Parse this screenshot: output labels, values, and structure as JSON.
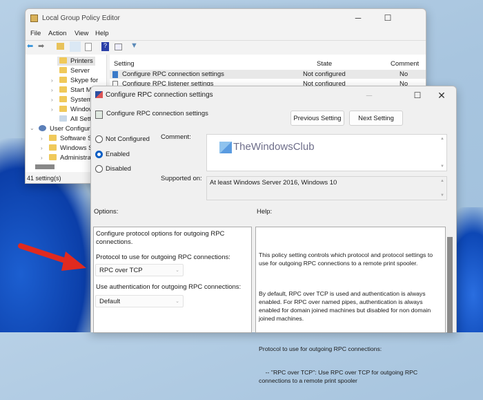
{
  "gpe": {
    "title": "Local Group Policy Editor",
    "menu": [
      "File",
      "Action",
      "View",
      "Help"
    ],
    "tree": [
      "Printers",
      "Server",
      "Skype for",
      "Start Me",
      "System",
      "Window",
      "All Setti",
      "User Configura",
      "Software Se",
      "Windows Se",
      "Administrat"
    ],
    "columns": {
      "setting": "Setting",
      "state": "State",
      "comment": "Comment"
    },
    "rows": [
      {
        "name": "Configure RPC connection settings",
        "state": "Not configured",
        "comment": "No"
      },
      {
        "name": "Configure RPC listener settings",
        "state": "Not configured",
        "comment": "No"
      }
    ],
    "status": "41 setting(s)"
  },
  "dialog": {
    "title": "Configure RPC connection settings",
    "heading": "Configure RPC connection settings",
    "prev": "Previous Setting",
    "next": "Next Setting",
    "radios": {
      "not_configured": "Not Configured",
      "enabled": "Enabled",
      "disabled": "Disabled",
      "selected": "Enabled"
    },
    "comment_label": "Comment:",
    "watermark": "TheWindowsClub",
    "supported_label": "Supported on:",
    "supported_value": "At least Windows Server 2016, Windows 10",
    "options_label": "Options:",
    "help_label": "Help:",
    "options": {
      "intro": "Configure protocol options for outgoing RPC connections.",
      "protocol_label": "Protocol to use for outgoing RPC connections:",
      "protocol_value": "RPC over TCP",
      "auth_label": "Use authentication for outgoing RPC connections:",
      "auth_value": "Default"
    },
    "help": [
      "This policy setting controls which protocol and protocol settings to use for outgoing RPC connections to a remote print spooler.",
      "By default, RPC over TCP is used and authentication is always enabled. For RPC over named pipes, authentication is always enabled for domain joined machines but disabled for non domain joined machines.",
      "Protocol to use for outgoing RPC connections:",
      "    -- \"RPC over TCP\": Use RPC over TCP for outgoing RPC connections to a remote print spooler"
    ]
  },
  "colors": {
    "accent": "#0a5ec4",
    "arrow": "#e02a1f"
  }
}
